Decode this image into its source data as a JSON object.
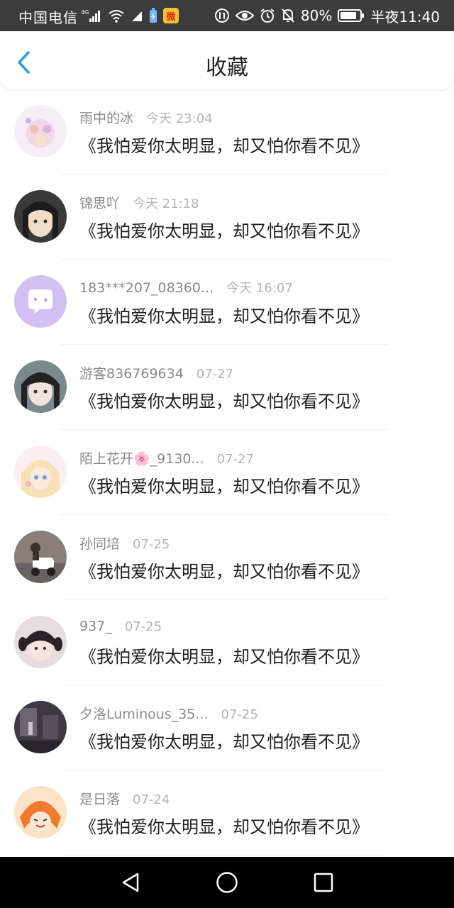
{
  "status_bar": {
    "carrier": "中国电信",
    "battery": "80%",
    "time": "半夜11:40"
  },
  "header": {
    "title": "收藏",
    "back_icon": "chevron-left-icon",
    "accent_color": "#2f9bf0"
  },
  "items": [
    {
      "username": "雨中的冰",
      "time": "今天 23:04",
      "content": "《我怕爱你太明显，却又怕你看不见》"
    },
    {
      "username": "锦思吖",
      "time": "今天 21:18",
      "content": "《我怕爱你太明显，却又怕你看不见》"
    },
    {
      "username": "183***207_08360...",
      "time": "今天 16:07",
      "content": "《我怕爱你太明显，却又怕你看不见》"
    },
    {
      "username": "游客836769634",
      "time": "07-27",
      "content": "《我怕爱你太明显，却又怕你看不见》"
    },
    {
      "username": "陌上花开🌸_9130...",
      "time": "07-27",
      "content": "《我怕爱你太明显，却又怕你看不见》"
    },
    {
      "username": "孙同培",
      "time": "07-25",
      "content": "《我怕爱你太明显，却又怕你看不见》"
    },
    {
      "username": "937_",
      "time": "07-25",
      "content": "《我怕爱你太明显，却又怕你看不见》"
    },
    {
      "username": "夕洛Luminous_35...",
      "time": "07-25",
      "content": "《我怕爱你太明显，却又怕你看不见》"
    },
    {
      "username": "是日落",
      "time": "07-24",
      "content": "《我怕爱你太明显，却又怕你看不见》"
    }
  ],
  "nav_bar": {
    "back_icon": "triangle-back-icon",
    "home_icon": "circle-home-icon",
    "recents_icon": "square-recents-icon"
  }
}
